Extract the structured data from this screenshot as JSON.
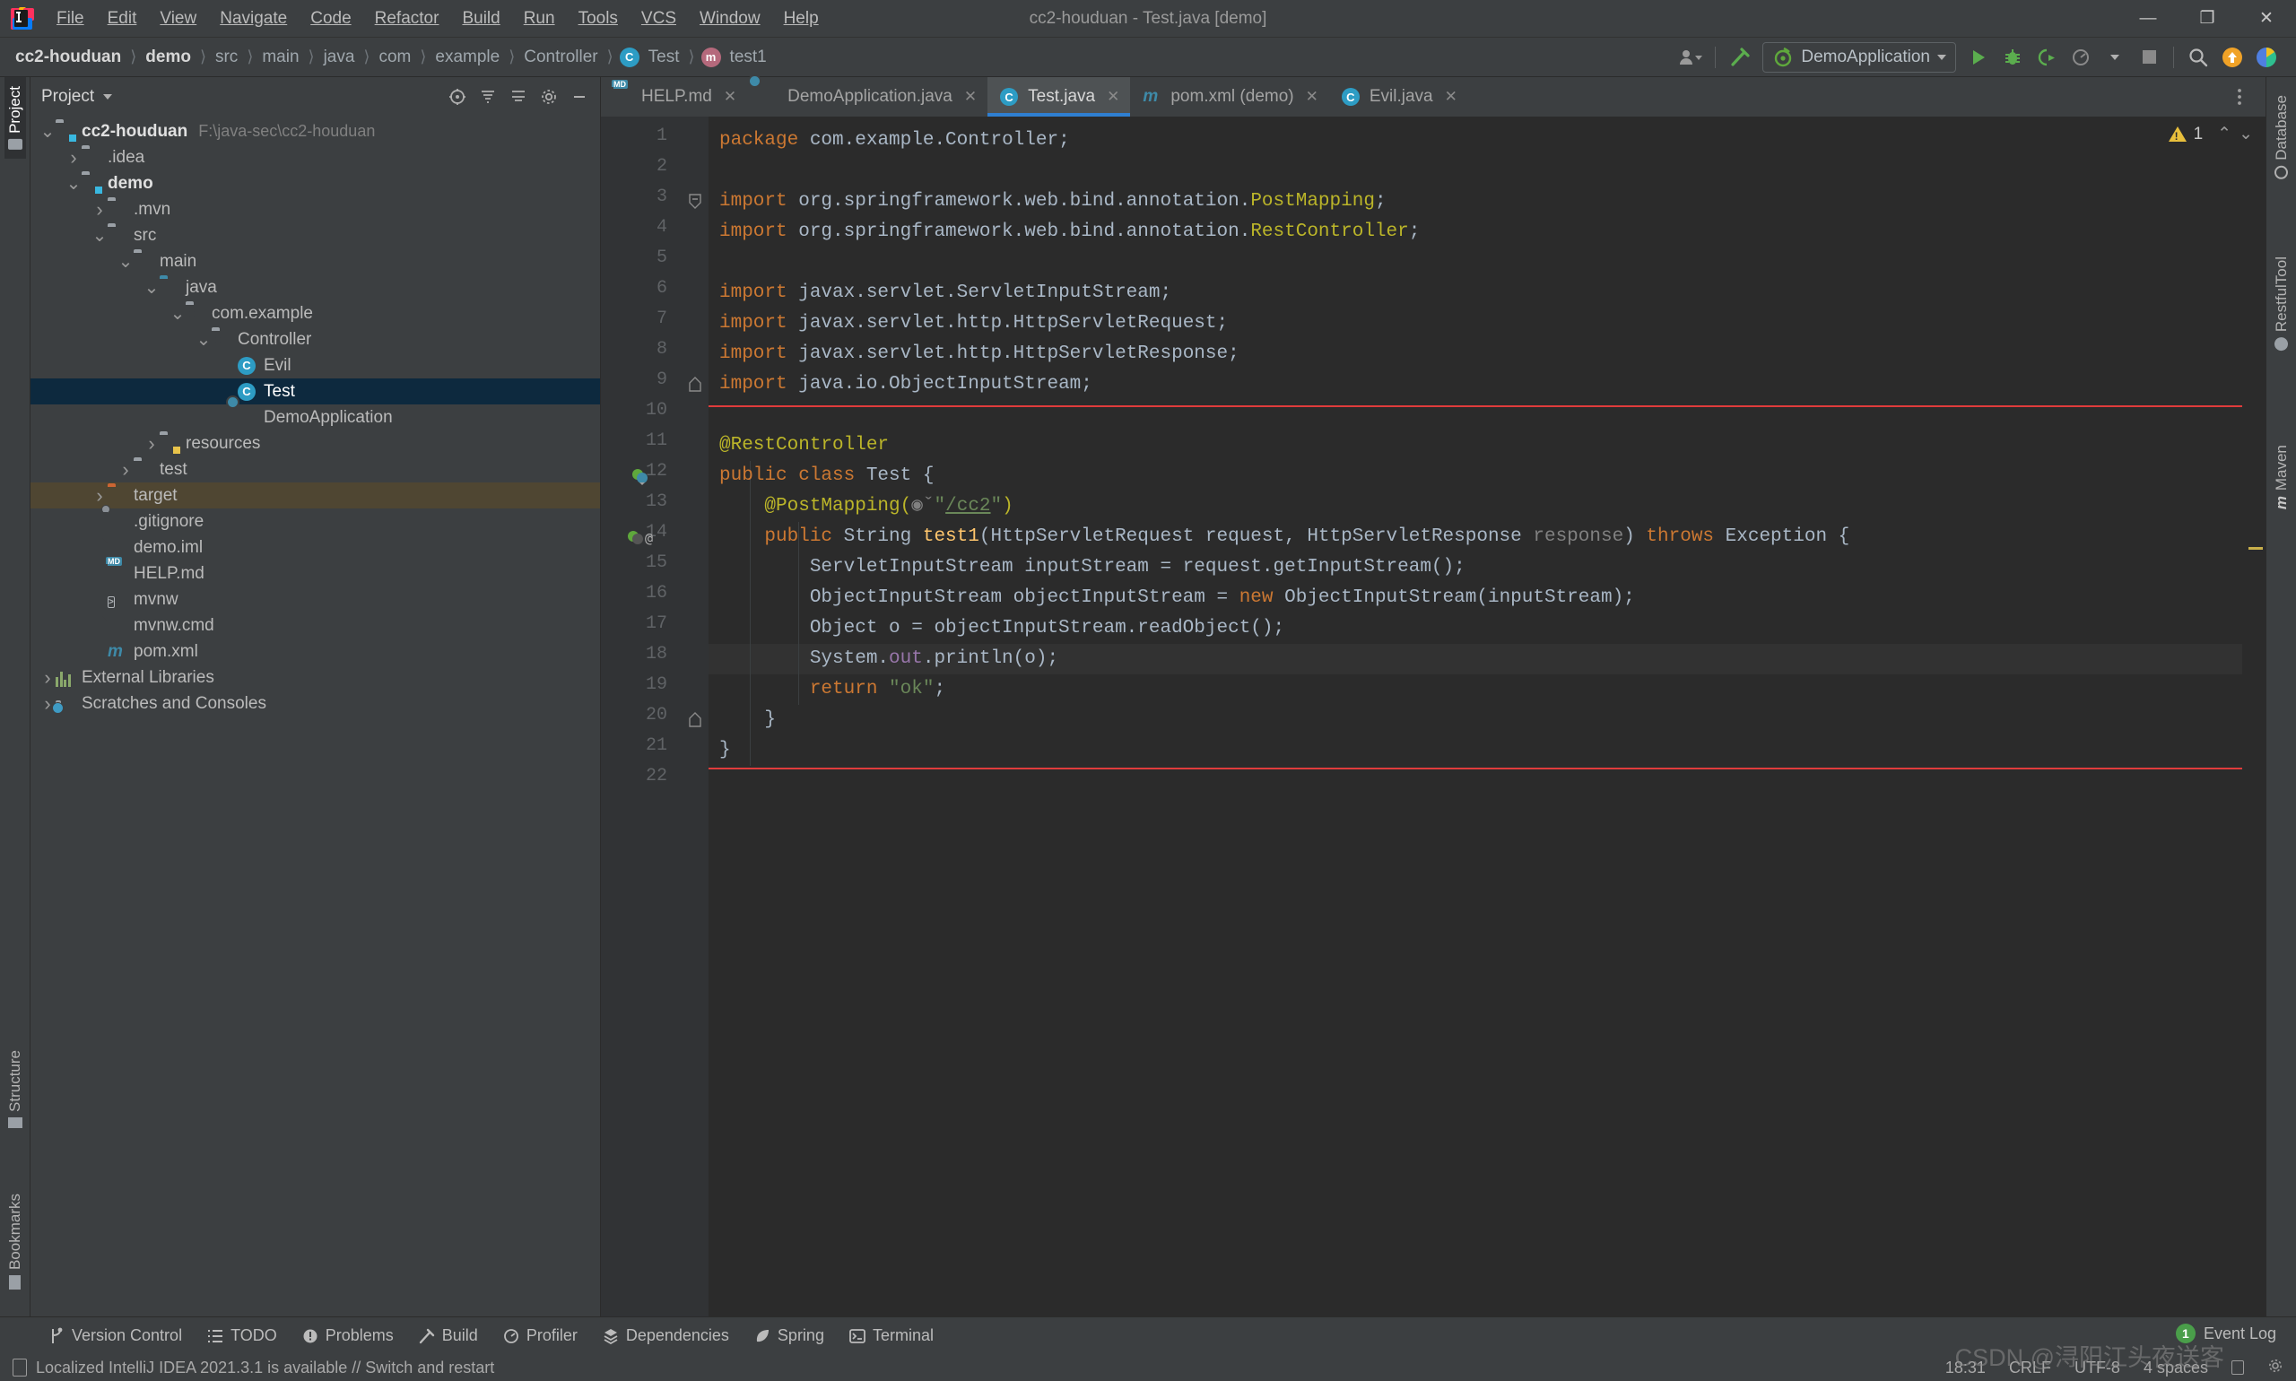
{
  "window": {
    "title": "cc2-houduan - Test.java [demo]",
    "minimize": "—",
    "maximize": "❐",
    "close": "✕"
  },
  "menu": [
    "File",
    "Edit",
    "View",
    "Navigate",
    "Code",
    "Refactor",
    "Build",
    "Run",
    "Tools",
    "VCS",
    "Window",
    "Help"
  ],
  "breadcrumb": [
    {
      "label": "cc2-houduan",
      "style": "bold"
    },
    {
      "label": "demo",
      "style": "bold"
    },
    {
      "label": "src",
      "style": "dim"
    },
    {
      "label": "main",
      "style": "dim"
    },
    {
      "label": "java",
      "style": "dim"
    },
    {
      "label": "com",
      "style": "dim"
    },
    {
      "label": "example",
      "style": "dim"
    },
    {
      "label": "Controller",
      "style": "dim"
    },
    {
      "label": "Test",
      "style": "dim",
      "icon": "class-icon",
      "icon_letter": "C"
    },
    {
      "label": "test1",
      "style": "dim",
      "icon": "method-icon",
      "icon_letter": "m"
    }
  ],
  "toolbar": {
    "user_icon": "user-settings-icon",
    "build_icon": "build-hammer-icon",
    "run_config": "DemoApplication",
    "run_icon": "run-icon",
    "debug_icon": "debug-icon",
    "run_coverage_icon": "run-with-coverage-icon",
    "profile_icon": "profiler-icon",
    "stop_icon": "stop-icon",
    "search_icon": "search-everywhere-icon",
    "update_icon": "update-project-icon",
    "ai_icon": "ide-features-icon"
  },
  "project_panel": {
    "title": "Project",
    "header_icons": [
      "select-opened-file-icon",
      "expand-all-icon",
      "collapse-all-icon",
      "settings-gear-icon",
      "hide-panel-icon"
    ],
    "tree": [
      {
        "label": "cc2-houduan",
        "path": "F:\\java-sec\\cc2-houduan",
        "indent": 0,
        "arrow": "down",
        "icon": "module-folder",
        "bold": true
      },
      {
        "label": ".idea",
        "indent": 1,
        "arrow": "right",
        "icon": "folder"
      },
      {
        "label": "demo",
        "indent": 1,
        "arrow": "down",
        "icon": "module-folder",
        "bold": true
      },
      {
        "label": ".mvn",
        "indent": 2,
        "arrow": "right",
        "icon": "folder"
      },
      {
        "label": "src",
        "indent": 2,
        "arrow": "down",
        "icon": "folder"
      },
      {
        "label": "main",
        "indent": 3,
        "arrow": "down",
        "icon": "folder"
      },
      {
        "label": "java",
        "indent": 4,
        "arrow": "down",
        "icon": "source-folder"
      },
      {
        "label": "com.example",
        "indent": 5,
        "arrow": "down",
        "icon": "package"
      },
      {
        "label": "Controller",
        "indent": 6,
        "arrow": "down",
        "icon": "package"
      },
      {
        "label": "Evil",
        "indent": 7,
        "arrow": "none",
        "icon": "java-class"
      },
      {
        "label": "Test",
        "indent": 7,
        "arrow": "none",
        "icon": "java-class",
        "selected": true
      },
      {
        "label": "DemoApplication",
        "indent": 7,
        "arrow": "none",
        "icon": "spring-class"
      },
      {
        "label": "resources",
        "indent": 4,
        "arrow": "right",
        "icon": "resources-folder"
      },
      {
        "label": "test",
        "indent": 3,
        "arrow": "right",
        "icon": "folder"
      },
      {
        "label": "target",
        "indent": 2,
        "arrow": "right",
        "icon": "excluded-folder",
        "highlight": true
      },
      {
        "label": ".gitignore",
        "indent": 2,
        "arrow": "none",
        "icon": "gitignore-file"
      },
      {
        "label": "demo.iml",
        "indent": 2,
        "arrow": "none",
        "icon": "iml-file"
      },
      {
        "label": "HELP.md",
        "indent": 2,
        "arrow": "none",
        "icon": "markdown-file"
      },
      {
        "label": "mvnw",
        "indent": 2,
        "arrow": "none",
        "icon": "shell-file"
      },
      {
        "label": "mvnw.cmd",
        "indent": 2,
        "arrow": "none",
        "icon": "cmd-file"
      },
      {
        "label": "pom.xml",
        "indent": 2,
        "arrow": "none",
        "icon": "maven-file"
      },
      {
        "label": "External Libraries",
        "indent": 0,
        "arrow": "right",
        "icon": "libraries"
      },
      {
        "label": "Scratches and Consoles",
        "indent": 0,
        "arrow": "right",
        "icon": "scratches"
      }
    ]
  },
  "left_strip": [
    {
      "label": "Project",
      "active": true,
      "icon": "project-icon"
    },
    {
      "label": "Structure",
      "active": false,
      "icon": "structure-icon"
    },
    {
      "label": "Bookmarks",
      "active": false,
      "icon": "bookmarks-icon"
    }
  ],
  "right_strip": [
    {
      "label": "Database",
      "icon": "database-icon"
    },
    {
      "label": "RestfulTool",
      "icon": "restful-icon"
    },
    {
      "label": "Maven",
      "icon": "maven-icon"
    }
  ],
  "editor_tabs": [
    {
      "label": "HELP.md",
      "icon": "markdown-file",
      "active": false
    },
    {
      "label": "DemoApplication.java",
      "icon": "spring-class",
      "active": false
    },
    {
      "label": "Test.java",
      "icon": "java-class",
      "active": true
    },
    {
      "label": "pom.xml (demo)",
      "icon": "maven-file",
      "active": false
    },
    {
      "label": "Evil.java",
      "icon": "java-class",
      "active": false
    }
  ],
  "editor": {
    "warning_count": "1",
    "warning_icon": "warning-triangle-icon",
    "prev_icon": "⌃",
    "next_icon": "⌄",
    "options_icon": "editor-options-icon",
    "current_line": 18,
    "lines": [
      {
        "n": 1,
        "tokens": [
          {
            "t": "package ",
            "c": "kw"
          },
          {
            "t": "com.example.Controller;",
            "c": "txt"
          }
        ]
      },
      {
        "n": 2,
        "tokens": []
      },
      {
        "n": 3,
        "tokens": [
          {
            "t": "import ",
            "c": "kw"
          },
          {
            "t": "org.springframework.web.bind.annotation.",
            "c": "txt"
          },
          {
            "t": "PostMapping",
            "c": "ann"
          },
          {
            "t": ";",
            "c": "txt"
          }
        ],
        "fold": "start"
      },
      {
        "n": 4,
        "tokens": [
          {
            "t": "import ",
            "c": "kw"
          },
          {
            "t": "org.springframework.web.bind.annotation.",
            "c": "txt"
          },
          {
            "t": "RestController",
            "c": "ann"
          },
          {
            "t": ";",
            "c": "txt"
          }
        ]
      },
      {
        "n": 5,
        "tokens": []
      },
      {
        "n": 6,
        "tokens": [
          {
            "t": "import ",
            "c": "kw"
          },
          {
            "t": "javax.servlet.ServletInputStream;",
            "c": "txt"
          }
        ]
      },
      {
        "n": 7,
        "tokens": [
          {
            "t": "import ",
            "c": "kw"
          },
          {
            "t": "javax.servlet.http.HttpServletRequest;",
            "c": "txt"
          }
        ]
      },
      {
        "n": 8,
        "tokens": [
          {
            "t": "import ",
            "c": "kw"
          },
          {
            "t": "javax.servlet.http.HttpServletResponse;",
            "c": "txt"
          }
        ]
      },
      {
        "n": 9,
        "tokens": [
          {
            "t": "import ",
            "c": "kw"
          },
          {
            "t": "java.io.ObjectInputStream;",
            "c": "txt"
          }
        ],
        "fold": "end"
      },
      {
        "n": 10,
        "tokens": []
      },
      {
        "n": 11,
        "tokens": [
          {
            "t": "@RestController",
            "c": "ann"
          }
        ]
      },
      {
        "n": 12,
        "tokens": [
          {
            "t": "public class ",
            "c": "kw"
          },
          {
            "t": "Test {",
            "c": "txt"
          }
        ],
        "gutter": "spring-bean-icon"
      },
      {
        "n": 13,
        "tokens": [
          {
            "t": "    @PostMapping(",
            "c": "ann"
          },
          {
            "t": "◉ˇ",
            "c": "grey"
          },
          {
            "t": "\"",
            "c": "str"
          },
          {
            "t": "/cc2",
            "c": "ulink"
          },
          {
            "t": "\"",
            "c": "str"
          },
          {
            "t": ")",
            "c": "ann"
          }
        ]
      },
      {
        "n": 14,
        "tokens": [
          {
            "t": "    public ",
            "c": "kw"
          },
          {
            "t": "String ",
            "c": "txt"
          },
          {
            "t": "test1",
            "c": "fn"
          },
          {
            "t": "(HttpServletRequest request, HttpServletResponse ",
            "c": "txt"
          },
          {
            "t": "response",
            "c": "grey"
          },
          {
            "t": ") ",
            "c": "txt"
          },
          {
            "t": "throws ",
            "c": "kw"
          },
          {
            "t": "Exception {",
            "c": "txt"
          }
        ],
        "gutter": "endpoint-icon"
      },
      {
        "n": 15,
        "tokens": [
          {
            "t": "        ServletInputStream inputStream = request.getInputStream();",
            "c": "txt"
          }
        ]
      },
      {
        "n": 16,
        "tokens": [
          {
            "t": "        ObjectInputStream objectInputStream = ",
            "c": "txt"
          },
          {
            "t": "new ",
            "c": "kw"
          },
          {
            "t": "ObjectInputStream(inputStream);",
            "c": "txt"
          }
        ]
      },
      {
        "n": 17,
        "tokens": [
          {
            "t": "        Object o = objectInputStream.readObject();",
            "c": "txt"
          }
        ]
      },
      {
        "n": 18,
        "tokens": [
          {
            "t": "        System.",
            "c": "txt"
          },
          {
            "t": "out",
            "c": "dim2"
          },
          {
            "t": ".println(o);",
            "c": "txt"
          }
        ]
      },
      {
        "n": 19,
        "tokens": [
          {
            "t": "        ",
            "c": "txt"
          },
          {
            "t": "return ",
            "c": "kw"
          },
          {
            "t": "\"ok\"",
            "c": "str"
          },
          {
            "t": ";",
            "c": "txt"
          }
        ]
      },
      {
        "n": 20,
        "tokens": [
          {
            "t": "    }",
            "c": "txt"
          }
        ],
        "fold": "end"
      },
      {
        "n": 21,
        "tokens": [
          {
            "t": "}",
            "c": "txt"
          }
        ]
      },
      {
        "n": 22,
        "tokens": []
      }
    ]
  },
  "bottom_bar": [
    {
      "label": "Version Control",
      "icon": "branch-icon"
    },
    {
      "label": "TODO",
      "icon": "todo-list-icon"
    },
    {
      "label": "Problems",
      "icon": "problems-icon"
    },
    {
      "label": "Build",
      "icon": "build-hammer-icon"
    },
    {
      "label": "Profiler",
      "icon": "profiler-icon"
    },
    {
      "label": "Dependencies",
      "icon": "dependencies-icon"
    },
    {
      "label": "Spring",
      "icon": "spring-leaf-icon"
    },
    {
      "label": "Terminal",
      "icon": "terminal-icon"
    }
  ],
  "status_bar": {
    "message": "Localized IntelliJ IDEA 2021.3.1 is available // Switch and restart",
    "message_icon": "notification-icon",
    "event_log": "Event Log",
    "event_count": "1",
    "time": "18:31",
    "line_sep": "CRLF",
    "encoding": "UTF-8",
    "indent": "4 spaces",
    "lock_icon": "read-only-lock-icon",
    "gear_icon": "settings-gear-icon",
    "watermark": "CSDN @浔阳江头夜送客"
  },
  "colors": {
    "accent_blue": "#2f7fd1",
    "selection": "#0d293e",
    "highlight_row": "#4f4632",
    "red_box": "#e03c3c",
    "bg_editor": "#2b2b2b",
    "bg_panel": "#3c3f41"
  }
}
